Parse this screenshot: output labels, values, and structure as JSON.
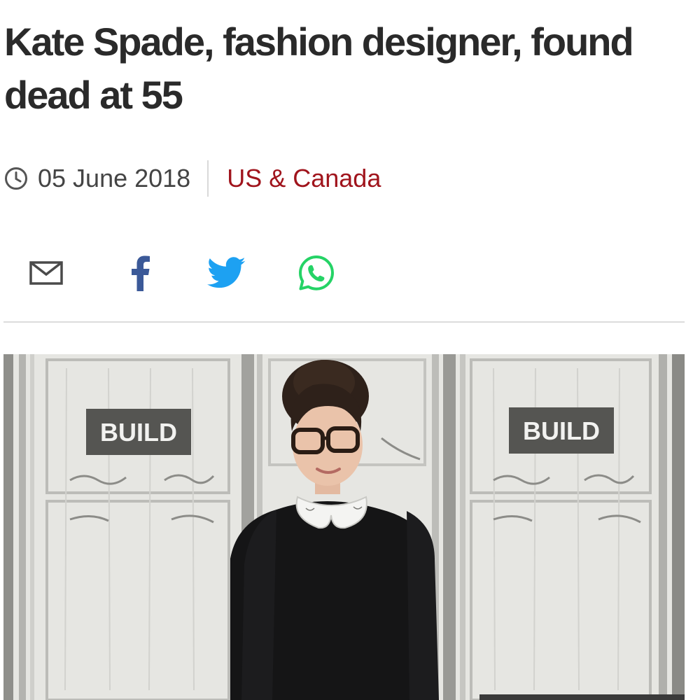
{
  "article": {
    "headline": "Kate Spade, fashion designer, found dead at 55",
    "date": "05 June 2018",
    "section": "US & Canada"
  },
  "share": {
    "icons": [
      "email-icon",
      "facebook-icon",
      "twitter-icon",
      "whatsapp-icon"
    ]
  },
  "hero_image": {
    "backdrop_sign_left": "BUILD",
    "backdrop_sign_right": "BUILD"
  },
  "colors": {
    "headline": "#2a2a2a",
    "date_text": "#444444",
    "section_link": "#a0141c",
    "facebook": "#3b5998",
    "twitter": "#1da1f2",
    "whatsapp": "#25d366"
  }
}
